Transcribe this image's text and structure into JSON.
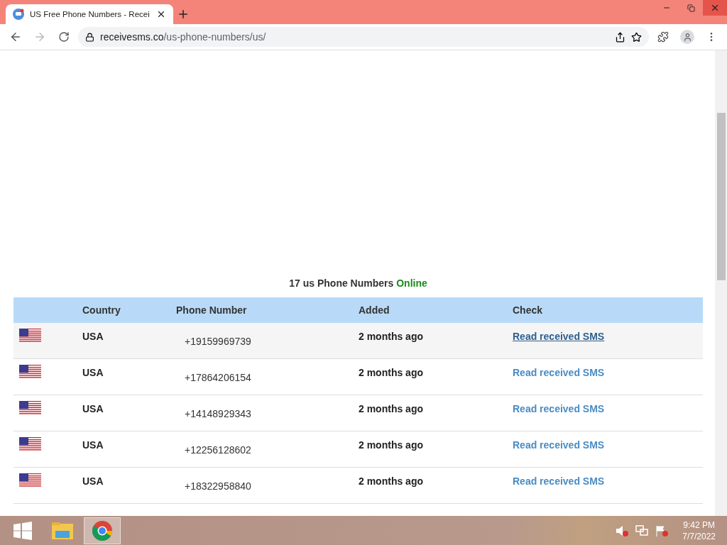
{
  "browser": {
    "tab": {
      "title": "US Free Phone Numbers - Recei"
    },
    "url": {
      "domain": "receivesms.co",
      "path": "/us-phone-numbers/us/"
    }
  },
  "page": {
    "heading": {
      "count": "17 us Phone Numbers",
      "status": "Online"
    },
    "table": {
      "columns": [
        "Country",
        "Phone Number",
        "Added",
        "Check"
      ],
      "rows": [
        {
          "country": "USA",
          "phone": "+19159969739",
          "added": "2 months ago",
          "link": "Read received SMS",
          "selected": true
        },
        {
          "country": "USA",
          "phone": "+17864206154",
          "added": "2 months ago",
          "link": "Read received SMS",
          "selected": false
        },
        {
          "country": "USA",
          "phone": "+14148929343",
          "added": "2 months ago",
          "link": "Read received SMS",
          "selected": false
        },
        {
          "country": "USA",
          "phone": "+12256128602",
          "added": "2 months ago",
          "link": "Read received SMS",
          "selected": false
        },
        {
          "country": "USA",
          "phone": "+18322958840",
          "added": "2 months ago",
          "link": "Read received SMS",
          "selected": false
        }
      ]
    }
  },
  "taskbar": {
    "time": "9:42 PM",
    "date": "7/7/2022"
  }
}
